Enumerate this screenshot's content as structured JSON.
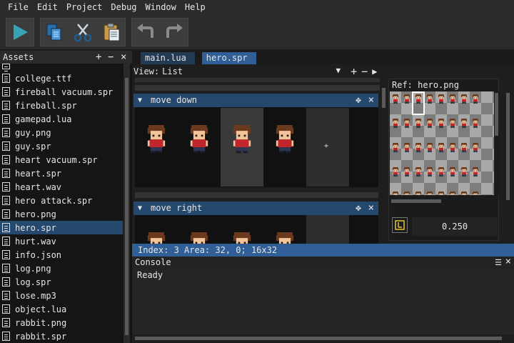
{
  "menu": [
    "File",
    "Edit",
    "Project",
    "Debug",
    "Window",
    "Help"
  ],
  "toolbar": {
    "buttons": [
      "play-icon",
      "copy-icon",
      "cut-icon",
      "paste-icon",
      "undo-icon",
      "redo-icon"
    ],
    "accent": "#36a3b7"
  },
  "assets": {
    "title": "Assets",
    "items": [
      "college.ttf",
      "fireball vacuum.spr",
      "fireball.spr",
      "gamepad.lua",
      "guy.png",
      "guy.spr",
      "heart vacuum.spr",
      "heart.spr",
      "heart.wav",
      "hero attack.spr",
      "hero.png",
      "hero.spr",
      "hurt.wav",
      "info.json",
      "log.png",
      "log.spr",
      "lose.mp3",
      "object.lua",
      "rabbit.png",
      "rabbit.spr"
    ],
    "selected": "hero.spr"
  },
  "tabs": [
    {
      "label": "main.lua",
      "active": false
    },
    {
      "label": "hero.spr",
      "active": true
    }
  ],
  "view": {
    "label": "View:",
    "value": "List"
  },
  "sequences": [
    {
      "name": "move down",
      "frame_count": 4,
      "selected_frame": 3
    },
    {
      "name": "move right",
      "frame_count": 4
    }
  ],
  "ref": {
    "label": "Ref:",
    "file": "hero.png",
    "duration": "0.250"
  },
  "status": {
    "text": "Index: 3   Area: 32, 0; 16x32"
  },
  "console": {
    "title": "Console",
    "text": "Ready"
  },
  "colors": {
    "selection": "#24486e",
    "status": "#2f5f96",
    "shirt": "#c0262b",
    "hair": "#6b3a1e",
    "skin": "#f1c49a"
  }
}
